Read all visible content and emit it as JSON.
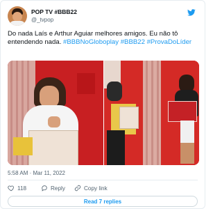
{
  "header": {
    "name": "POP TV #BBB22",
    "handle": "@_tvpop"
  },
  "tweet": {
    "text_parts": [
      {
        "t": "Do nada Laís e Arthur Aguiar melhores amigos. Eu não tô entendendo nada. ",
        "type": "text"
      },
      {
        "t": "#BBBNoGloboplay",
        "type": "hashtag"
      },
      {
        "t": " ",
        "type": "text"
      },
      {
        "t": "#BBB22",
        "type": "hashtag"
      },
      {
        "t": " ",
        "type": "text"
      },
      {
        "t": "#ProvaDoLíder",
        "type": "hashtag"
      }
    ]
  },
  "meta": {
    "timestamp": "5:58 AM · Mar 11, 2022",
    "info_icon": "info-icon"
  },
  "actions": {
    "like_count": "118",
    "reply_label": "Reply",
    "copy_link_label": "Copy link"
  },
  "read_replies_label": "Read 7 replies",
  "colors": {
    "accent": "#1d9bf0",
    "heart": "#f91880",
    "media_red": "#c81f22"
  },
  "icons": {
    "bird": "twitter-bird-icon",
    "heart": "heart-icon",
    "reply": "reply-icon",
    "link": "link-icon"
  }
}
